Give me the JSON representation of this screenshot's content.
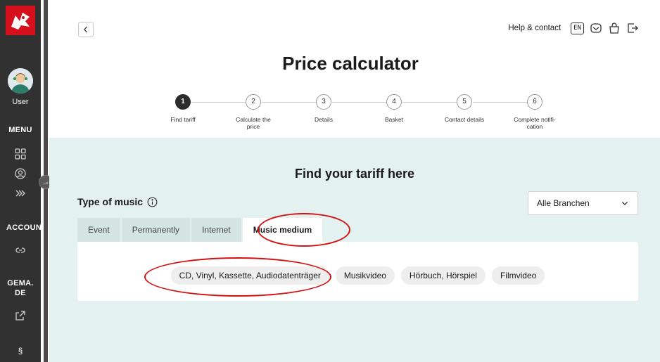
{
  "sidebar": {
    "user_label": "User",
    "menu_label": "MENU",
    "account_label": "ACCOUN",
    "gema_label_line1": "GEMA.",
    "gema_label_line2": "DE",
    "section_sign": "§",
    "icons": [
      "grid-icon",
      "user-circle-icon",
      "double-chevron-icon",
      "link-icon",
      "external-link-icon"
    ]
  },
  "header": {
    "help_label": "Help & contact",
    "language": "EN",
    "title": "Price calculator"
  },
  "stepper": {
    "steps": [
      {
        "number": "1",
        "label": "Find tariff"
      },
      {
        "number": "2",
        "label": "Calculate the price"
      },
      {
        "number": "3",
        "label": "Details"
      },
      {
        "number": "4",
        "label": "Basket"
      },
      {
        "number": "5",
        "label": "Contact details"
      },
      {
        "number": "6",
        "label": "Complete notifi-cation"
      }
    ],
    "active_index": 0
  },
  "main": {
    "heading": "Find your tariff here",
    "type_label": "Type of music",
    "dropdown_value": "Alle Branchen",
    "tabs": [
      {
        "label": "Event"
      },
      {
        "label": "Permanently"
      },
      {
        "label": "Internet"
      },
      {
        "label": "Music medium"
      }
    ],
    "active_tab": 3,
    "chips": [
      {
        "label": "CD, Vinyl, Kassette, Audiodatenträger"
      },
      {
        "label": "Musikvideo"
      },
      {
        "label": "Hörbuch, Hörspiel"
      },
      {
        "label": "Filmvideo"
      }
    ]
  },
  "colors": {
    "sidebar_bg": "#313131",
    "brand_red": "#d4101c",
    "content_bg": "#e3f1f0",
    "annotation_red": "#d51010"
  }
}
